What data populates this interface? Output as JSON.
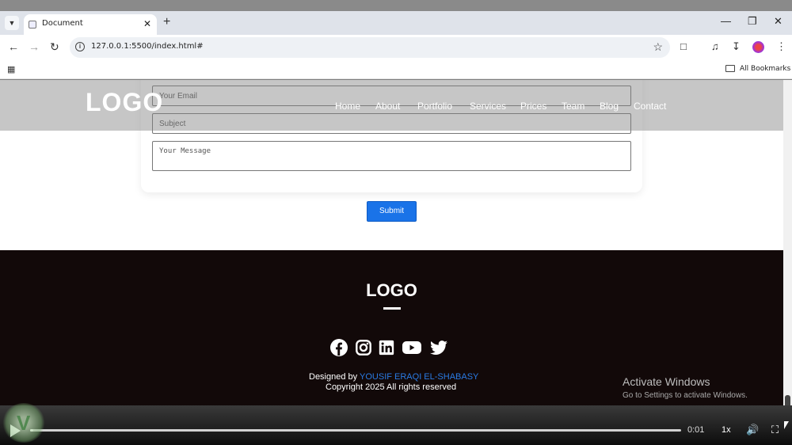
{
  "browser": {
    "tab_title": "Document",
    "url": "127.0.0.1:5500/index.html#",
    "bookmarks_label": "All Bookmarks"
  },
  "site": {
    "logo": "LOGO",
    "nav": [
      "Home",
      "About",
      "Portfolio",
      "Services",
      "Prices",
      "Team",
      "Blog",
      "Contact"
    ]
  },
  "form": {
    "email_placeholder": "Your Email",
    "subject_placeholder": "Subject",
    "message_placeholder": "Your Message",
    "submit_label": "Submit"
  },
  "footer": {
    "logo": "LOGO",
    "designed_prefix": "Designed by",
    "author": "YOUSIF ERAQI EL-SHABASY",
    "copyright": "Copyright 2025 All rights reserved",
    "socials": [
      "facebook-icon",
      "instagram-icon",
      "linkedin-icon",
      "youtube-icon",
      "twitter-icon"
    ]
  },
  "os": {
    "activate_title": "Activate Windows",
    "activate_sub": "Go to Settings to activate Windows."
  },
  "player": {
    "time": "0:01",
    "speed": "1x",
    "progress_fraction": 0.005
  },
  "colors": {
    "accent": "#1a73e8",
    "footer_bg": "#120909",
    "author_link": "#2a7be4"
  }
}
